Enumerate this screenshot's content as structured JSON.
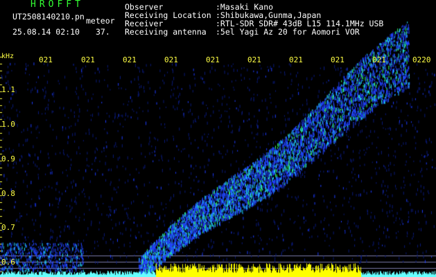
{
  "header": {
    "app_name": "HROFFT",
    "file_name": "UT2508140210.pn",
    "mode": "meteor",
    "datetime": "25.08.14 02:10",
    "count": "37."
  },
  "info": [
    {
      "label": "Observer",
      "value": ":Masaki Kano"
    },
    {
      "label": "Receiving Location",
      "value": ":Shibukawa,Gunma,Japan"
    },
    {
      "label": "Receiver",
      "value": ":RTL-SDR SDR# 43dB L15 114.1MHz USB"
    },
    {
      "label": "Receiving antenna",
      "value": ":5el Yagi Az 20 for Aomori VOR"
    }
  ],
  "spectrogram": {
    "unit": "kHz",
    "y_ticks": [
      "1.1",
      "1.0",
      "0.9",
      "0.8",
      "0.7",
      "0.6"
    ],
    "x_ticks": [
      "021",
      "021",
      "021",
      "021",
      "021",
      "021",
      "021",
      "021",
      "021",
      "0220"
    ],
    "colors": {
      "text_green": "#33ff33",
      "axis_yellow": "#ffff44",
      "signal_blue": "#2244ff",
      "signal_cyan": "#22ddff",
      "signal_green": "#33ff66",
      "baseline_cyan": "#66ffff",
      "baseline_yellow": "#ffff00"
    }
  }
}
